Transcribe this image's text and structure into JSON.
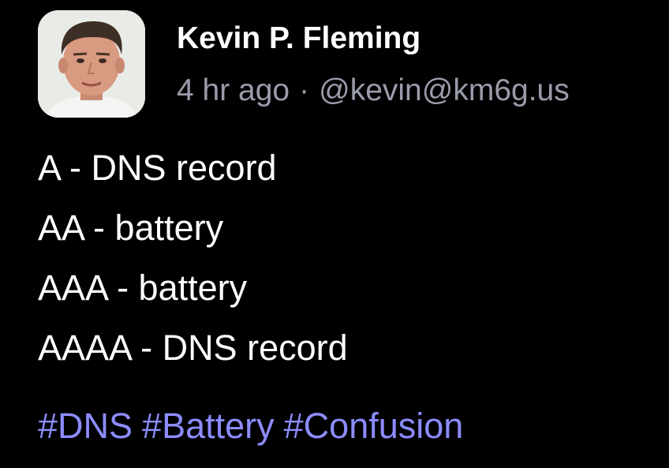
{
  "post": {
    "author": {
      "name": "Kevin P. Fleming",
      "handle": "@kevin@km6g.us",
      "avatar_icon": "profile-photo"
    },
    "timestamp": "4 hr ago",
    "separator": "·",
    "lines": [
      "A - DNS record",
      "AA - battery",
      "AAA - battery",
      "AAAA - DNS record"
    ],
    "hashtags": [
      "#DNS",
      "#Battery",
      "#Confusion"
    ]
  },
  "colors": {
    "background": "#000000",
    "text": "#ffffff",
    "meta": "#9a9cab",
    "hashtag": "#8c8cff"
  }
}
